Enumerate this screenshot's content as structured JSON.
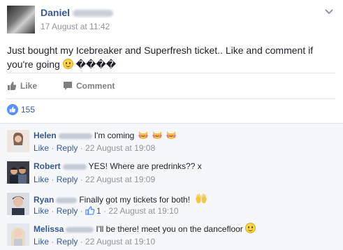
{
  "post": {
    "author_name": "Daniel",
    "timestamp": "17 August at 11:42",
    "text_lines": [
      "Just bought my Icebreaker and Superfresh ticket.. Like and comment if",
      "you're going"
    ],
    "trailing_glyphs": "����",
    "actions": {
      "like_label": "Like",
      "comment_label": "Comment"
    },
    "reactions_count": "155"
  },
  "comments": [
    {
      "name": "Helen",
      "text": "I'm coming",
      "emojis": [
        "happy-cat-icon",
        "happy-cat-icon",
        "happy-cat-icon"
      ],
      "like": "Like",
      "reply": "Reply",
      "time": "22 August at 19:08",
      "likes": ""
    },
    {
      "name": "Robert",
      "text": "YES! Where are predrinks?? x",
      "emojis": [],
      "like": "Like",
      "reply": "Reply",
      "time": "22 August at 19:09",
      "likes": ""
    },
    {
      "name": "Ryan",
      "text": "Finally got my tickets for both!",
      "emojis": [
        "raised-hands-icon"
      ],
      "like": "Like",
      "reply": "Reply",
      "time": "22 August at 19:10",
      "likes": "1"
    },
    {
      "name": "Melissa",
      "text": "I'll be there! meet you on the dancefloor",
      "emojis": [
        "smile-icon"
      ],
      "like": "Like",
      "reply": "Reply",
      "time": "22 August at 19:10",
      "likes": ""
    }
  ],
  "colors": {
    "link": "#365899",
    "meta": "#90949c",
    "like_badge": "#5890ff"
  }
}
